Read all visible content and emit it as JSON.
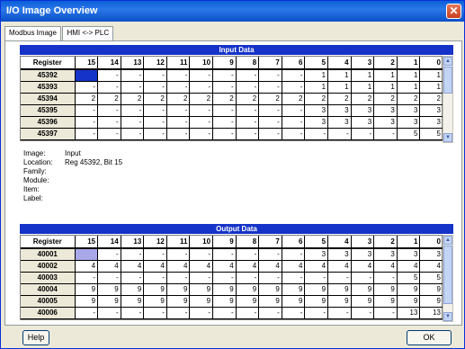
{
  "window": {
    "title": "I/O Image Overview",
    "close_glyph": "✕"
  },
  "tabs": [
    {
      "label": "Modbus Image"
    },
    {
      "label": "HMI <-> PLC"
    }
  ],
  "bit_headers": [
    "15",
    "14",
    "13",
    "12",
    "11",
    "10",
    "9",
    "8",
    "7",
    "6",
    "5",
    "4",
    "3",
    "2",
    "1",
    "0"
  ],
  "input": {
    "title": "Input Data",
    "register_header": "Register",
    "rows": [
      {
        "reg": "45392",
        "cells": [
          "",
          "-",
          "-",
          "-",
          "-",
          "-",
          "-",
          "-",
          "-",
          "-",
          "1",
          "1",
          "1",
          "1",
          "1",
          "1"
        ]
      },
      {
        "reg": "45393",
        "cells": [
          "-",
          "-",
          "-",
          "-",
          "-",
          "-",
          "-",
          "-",
          "-",
          "-",
          "1",
          "1",
          "1",
          "1",
          "1",
          "1"
        ]
      },
      {
        "reg": "45394",
        "cells": [
          "2",
          "2",
          "2",
          "2",
          "2",
          "2",
          "2",
          "2",
          "2",
          "2",
          "2",
          "2",
          "2",
          "2",
          "2",
          "2"
        ]
      },
      {
        "reg": "45395",
        "cells": [
          "-",
          "-",
          "-",
          "-",
          "-",
          "-",
          "-",
          "-",
          "-",
          "-",
          "3",
          "3",
          "3",
          "3",
          "3",
          "3"
        ]
      },
      {
        "reg": "45396",
        "cells": [
          "-",
          "-",
          "-",
          "-",
          "-",
          "-",
          "-",
          "-",
          "-",
          "-",
          "3",
          "3",
          "3",
          "3",
          "3",
          "3"
        ]
      },
      {
        "reg": "45397",
        "cells": [
          "-",
          "-",
          "-",
          "-",
          "-",
          "-",
          "-",
          "-",
          "-",
          "-",
          "-",
          "-",
          "-",
          "-",
          "5",
          "5"
        ]
      }
    ]
  },
  "info": {
    "image_label": "Image:",
    "image_value": "Input",
    "location_label": "Location:",
    "location_value": "Reg 45392, Bit 15",
    "family_label": "Family:",
    "module_label": "Module:",
    "item_label": "Item:",
    "label_label": "Label:"
  },
  "output": {
    "title": "Output Data",
    "register_header": "Register",
    "rows": [
      {
        "reg": "40001",
        "cells": [
          "",
          "-",
          "-",
          "-",
          "-",
          "-",
          "-",
          "-",
          "-",
          "-",
          "3",
          "3",
          "3",
          "3",
          "3",
          "3"
        ]
      },
      {
        "reg": "40002",
        "cells": [
          "4",
          "4",
          "4",
          "4",
          "4",
          "4",
          "4",
          "4",
          "4",
          "4",
          "4",
          "4",
          "4",
          "4",
          "4",
          "4"
        ]
      },
      {
        "reg": "40003",
        "cells": [
          "-",
          "-",
          "-",
          "-",
          "-",
          "-",
          "-",
          "-",
          "-",
          "-",
          "-",
          "-",
          "-",
          "-",
          "5",
          "5"
        ]
      },
      {
        "reg": "40004",
        "cells": [
          "9",
          "9",
          "9",
          "9",
          "9",
          "9",
          "9",
          "9",
          "9",
          "9",
          "9",
          "9",
          "9",
          "9",
          "9",
          "9"
        ]
      },
      {
        "reg": "40005",
        "cells": [
          "9",
          "9",
          "9",
          "9",
          "9",
          "9",
          "9",
          "9",
          "9",
          "9",
          "9",
          "9",
          "9",
          "9",
          "9",
          "9"
        ]
      },
      {
        "reg": "40006",
        "cells": [
          "-",
          "-",
          "-",
          "-",
          "-",
          "-",
          "-",
          "-",
          "-",
          "-",
          "-",
          "-",
          "-",
          "-",
          "13",
          "13"
        ]
      }
    ]
  },
  "buttons": {
    "help": "Help",
    "ok": "OK"
  },
  "colors": {
    "header_blue": "#1533c8",
    "selected_input": "#1533c8",
    "selected_output": "#a8a8e8"
  }
}
